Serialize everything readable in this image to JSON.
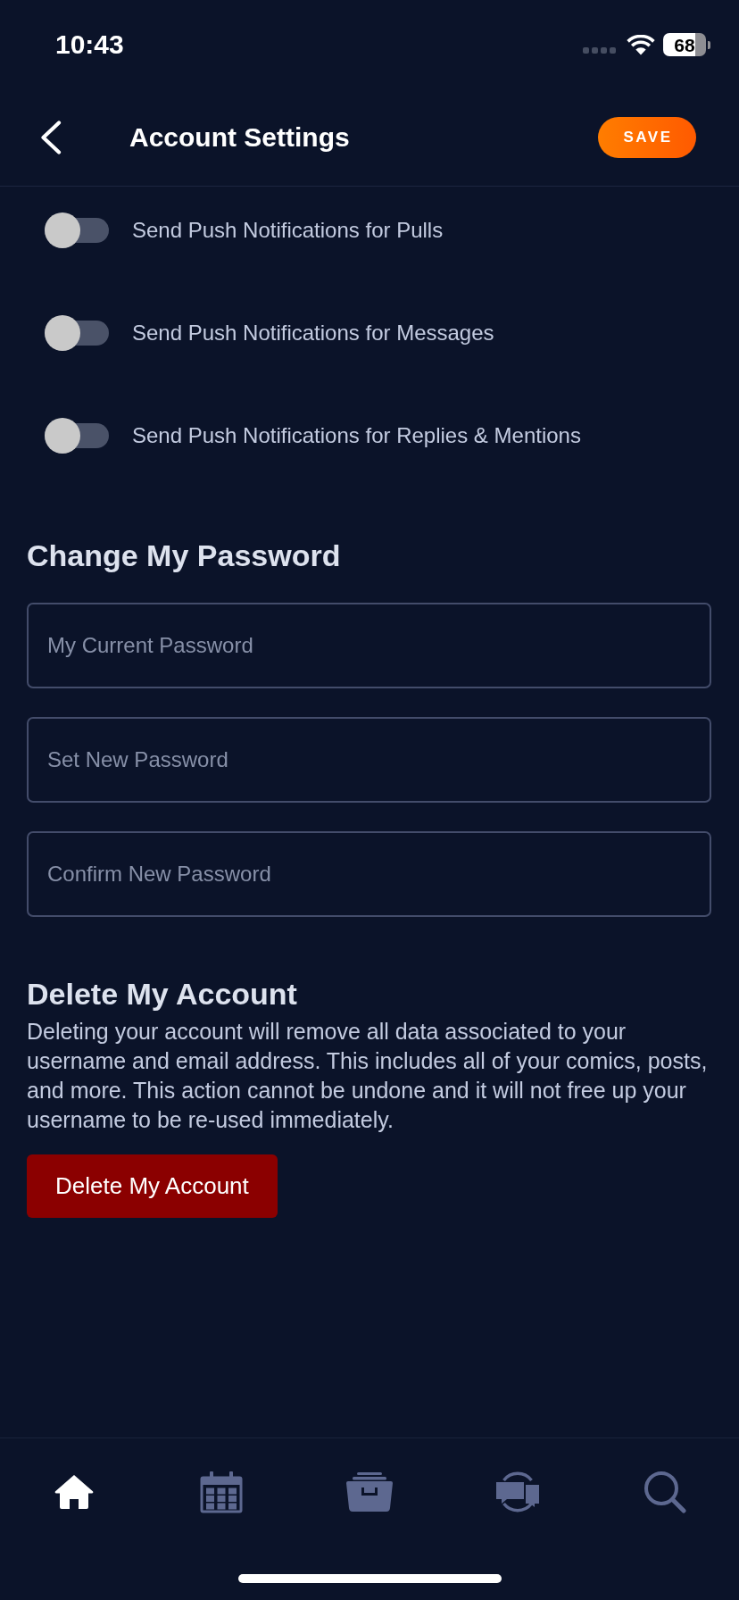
{
  "status_bar": {
    "time": "10:43",
    "battery": "68"
  },
  "header": {
    "title": "Account Settings",
    "save_label": "SAVE"
  },
  "notifications": [
    {
      "label": "Send Push Notifications for Pulls",
      "on": false
    },
    {
      "label": "Send Push Notifications for Messages",
      "on": false
    },
    {
      "label": "Send Push Notifications for Replies & Mentions",
      "on": false
    }
  ],
  "change_password": {
    "heading": "Change My Password",
    "fields": [
      {
        "placeholder": "My Current Password"
      },
      {
        "placeholder": "Set New Password"
      },
      {
        "placeholder": "Confirm New Password"
      }
    ]
  },
  "delete_account": {
    "heading": "Delete My Account",
    "description": "Deleting your account will remove all data associated to your username and email address. This includes all of your comics, posts, and more. This action cannot be undone and it will not free up your username to be re-used immediately.",
    "button": "Delete My Account"
  },
  "tab_bar": {
    "tabs": [
      {
        "kind": "home",
        "selected": true
      },
      {
        "kind": "calendar",
        "selected": false
      },
      {
        "kind": "drawer",
        "selected": false
      },
      {
        "kind": "chat",
        "selected": false
      },
      {
        "kind": "search",
        "selected": false
      }
    ]
  }
}
